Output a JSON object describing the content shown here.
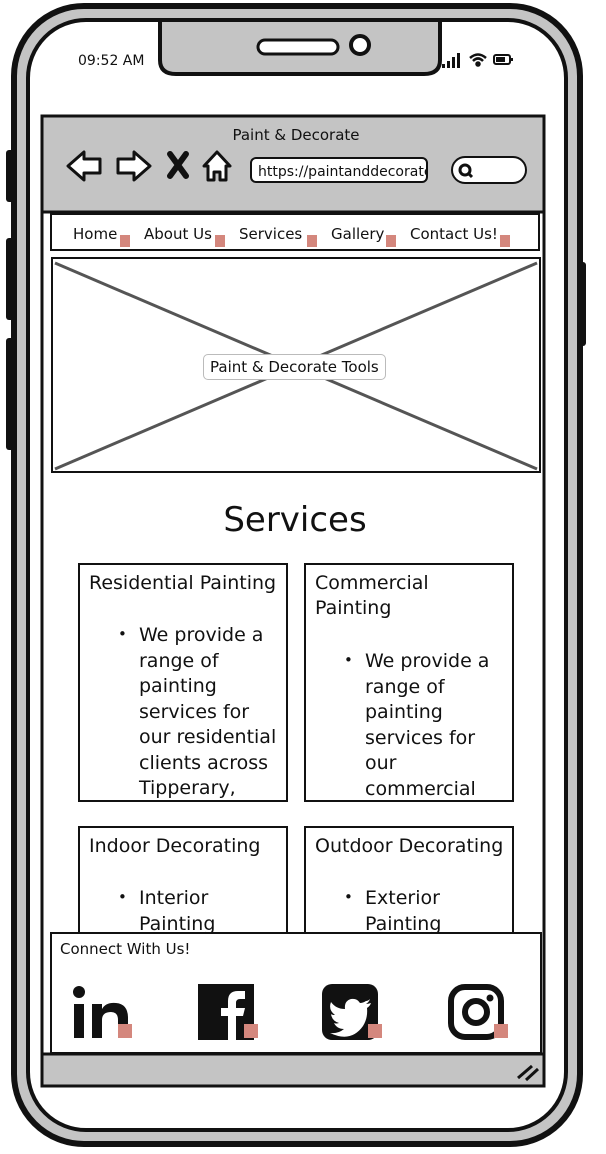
{
  "status_bar": {
    "time": "09:52 AM"
  },
  "browser": {
    "title": "Paint & Decorate",
    "url": "https://paintanddecorate"
  },
  "nav": {
    "items": [
      {
        "label": "Home"
      },
      {
        "label": "About Us"
      },
      {
        "label": "Services"
      },
      {
        "label": "Gallery"
      },
      {
        "label": "Contact Us!"
      }
    ]
  },
  "hero": {
    "label": "Paint & Decorate Tools"
  },
  "services": {
    "title": "Services",
    "cards": [
      {
        "title_lines": [
          "Residential Painting"
        ],
        "bullet_lines": [
          "We provide a",
          "range of",
          "painting",
          "services for",
          "our residential",
          "clients across",
          "Tipperary,"
        ]
      },
      {
        "title_lines": [
          "Commercial",
          "Painting"
        ],
        "bullet_lines": [
          "We provide a",
          "range of",
          "painting",
          "services for",
          "our",
          "commercial"
        ]
      },
      {
        "title_lines": [
          "Indoor Decorating"
        ],
        "bullet_lines": [
          "Interior",
          "Painting"
        ]
      },
      {
        "title_lines": [
          "Outdoor Decorating"
        ],
        "bullet_lines": [
          "Exterior",
          "Painting"
        ]
      }
    ]
  },
  "footer": {
    "title": "Connect With Us!",
    "social": [
      {
        "icon": "linkedin-icon"
      },
      {
        "icon": "facebook-icon"
      },
      {
        "icon": "twitter-icon"
      },
      {
        "icon": "instagram-icon"
      }
    ]
  },
  "colors": {
    "frame_gray": "#c4c4c4",
    "link_marker": "#d4877d"
  }
}
